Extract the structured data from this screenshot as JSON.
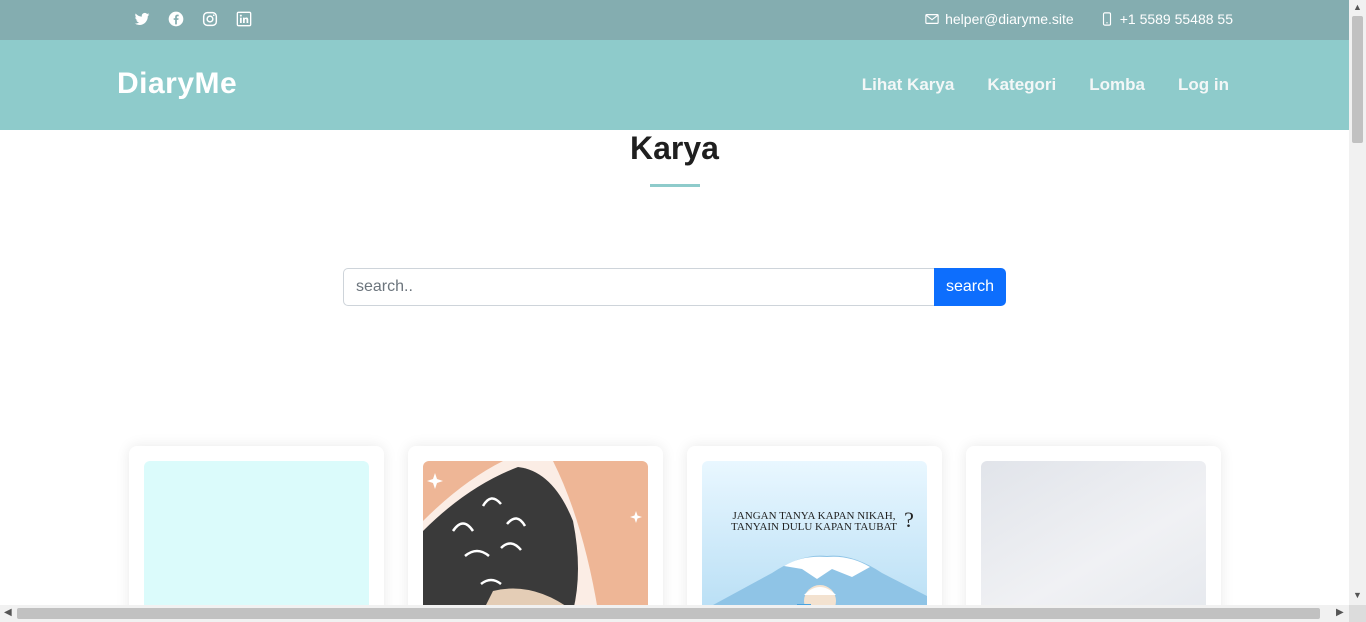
{
  "topbar": {
    "social": [
      "twitter-icon",
      "facebook-icon",
      "instagram-icon",
      "linkedin-icon"
    ],
    "email": "helper@diaryme.site",
    "phone": "+1 5589 55488 55"
  },
  "navbar": {
    "brand": "DiaryMe",
    "menu": [
      "Lihat Karya",
      "Kategori",
      "Lomba",
      "Log in"
    ]
  },
  "page": {
    "title": "Karya"
  },
  "search": {
    "placeholder": "search..",
    "button_label": "search"
  },
  "cards": [
    {
      "image": "light-cyan-thumbnail"
    },
    {
      "image": "illustration-black-flag-thumbnail"
    },
    {
      "image": "illustration-mountain-thumbnail",
      "caption": "JANGAN TANYA KAPAN NIKAH, TANYAIN DULU KAPAN TAUBAT",
      "mark": "?"
    },
    {
      "image": "grey-gradient-thumbnail"
    }
  ],
  "colors": {
    "topbar": "#84adb0",
    "navbar": "#8ecbcb",
    "accent": "#0d6efd"
  }
}
